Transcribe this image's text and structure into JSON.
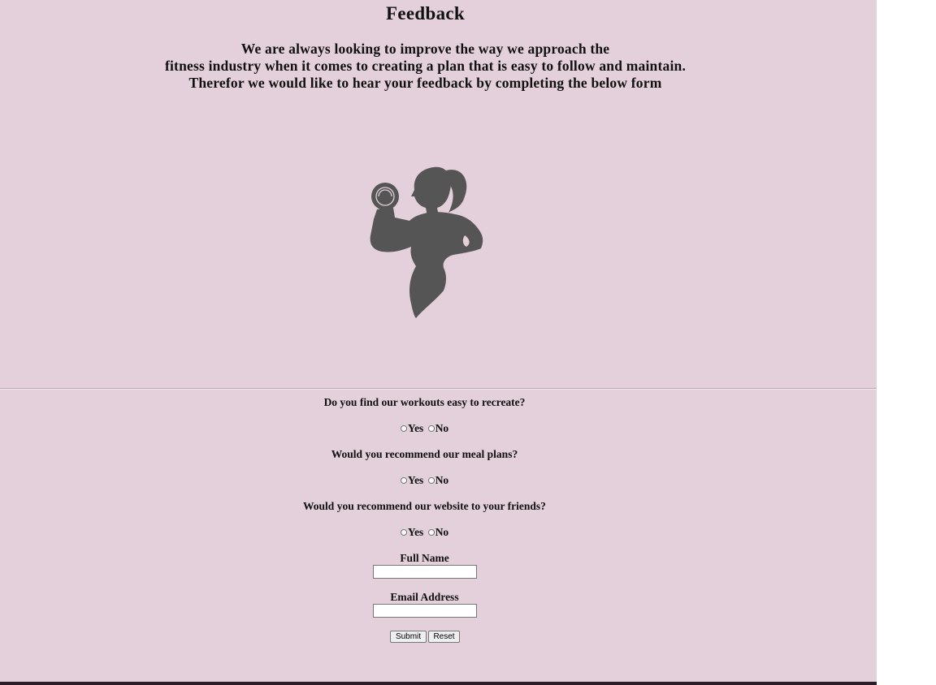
{
  "page": {
    "title": "Feedback",
    "intro": [
      "We are always looking to improve the way we approach the",
      "fitness industry when it comes to creating a plan that is easy to follow and maintain.",
      "Therefor we would like to hear your feedback by completing the below form"
    ],
    "hero_icon": "woman-lifting-dumbbell-icon",
    "colors": {
      "background": "#e4d0da",
      "silhouette": "#555555",
      "footer": "#2b1e2a"
    }
  },
  "form": {
    "questions": [
      {
        "text": "Do you find our workouts easy to recreate?",
        "yes": "Yes",
        "no": "No"
      },
      {
        "text": "Would you recommend our meal plans?",
        "yes": "Yes",
        "no": "No"
      },
      {
        "text": "Would you recommend our website to your friends?",
        "yes": "Yes",
        "no": "No"
      }
    ],
    "full_name": {
      "label": "Full Name",
      "value": ""
    },
    "email": {
      "label": "Email Address",
      "value": ""
    },
    "submit_label": "Submit",
    "reset_label": "Reset"
  }
}
